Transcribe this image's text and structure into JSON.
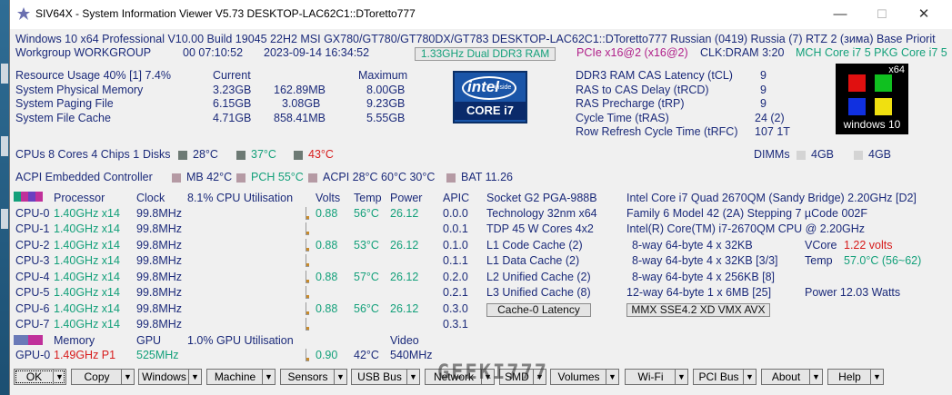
{
  "window": {
    "title": "SIV64X - System Information Viewer V5.73 DESKTOP-LAC62C1::DToretto777",
    "minimize": "—",
    "maximize": "☐",
    "close": "✕"
  },
  "sysline1": "Windows 10 x64 Professional  V10.00  Build 19045  22H2  MSI GX780/GT780/GT780DX/GT783  DESKTOP-LAC62C1::DToretto777  Russian (0419)  Russia (7)  RTZ 2 (зима)  Base Priorit",
  "sysline2": {
    "workgroup": "Workgroup WORKGROUP",
    "uptime": "00 07:10:52",
    "datetime": "2023-09-14 16:34:52",
    "mem_box": "1.33GHz Dual DDR3 RAM",
    "pcie": "PCIe x16@2 (x16@2)",
    "clk": "CLK:DRAM 3:20",
    "mch": "MCH Core i7 5  PKG Core i7 5"
  },
  "resources": {
    "header": "Resource Usage 40% [1] 7.4%",
    "current_h": "Current",
    "maximum_h": "Maximum",
    "rows": [
      {
        "label": "System Physical Memory",
        "cur": "3.23GB",
        "free": "162.89MB",
        "max": "8.00GB"
      },
      {
        "label": "System Paging File",
        "cur": "6.15GB",
        "free": "3.08GB",
        "max": "9.23GB"
      },
      {
        "label": "System File Cache",
        "cur": "4.71GB",
        "free": "858.41MB",
        "max": "5.55GB"
      }
    ]
  },
  "intel_logo": {
    "brand": "intel",
    "inside": "inside",
    "model": "CORE i7"
  },
  "win10_logo": {
    "x64": "x64",
    "label": "windows 10"
  },
  "timings": [
    {
      "label": "DDR3 RAM CAS Latency (tCL)",
      "value": "9"
    },
    {
      "label": "RAS to CAS Delay (tRCD)",
      "value": "9"
    },
    {
      "label": "RAS Precharge (tRP)",
      "value": "9"
    },
    {
      "label": "Cycle Time (tRAS)",
      "value": "24 (2)"
    },
    {
      "label": "Row Refresh Cycle Time (tRFC)",
      "value": "107 1T"
    }
  ],
  "cpus_line": {
    "label": "CPUs 8 Cores 4 Chips 1",
    "disks": "Disks",
    "d1": "28°C",
    "d2": "37°C",
    "d3": "43°C",
    "dimms": "DIMMs",
    "dimm1": "4GB",
    "dimm2": "4GB"
  },
  "acpi_line": {
    "label": "ACPI Embedded Controller",
    "mb": "MB 42°C",
    "pch": "PCH 55°C",
    "acpi": "ACPI 28°C 60°C 30°C",
    "bat": "BAT 11.26"
  },
  "cpu_table": {
    "h_processor": "Processor",
    "h_clock": "Clock",
    "h_util": "8.1% CPU Utilisation",
    "h_volts": "Volts",
    "h_temp": "Temp",
    "h_power": "Power",
    "h_apic": "APIC",
    "rows": [
      {
        "name": "CPU-0",
        "freq": "1.40GHz x14",
        "clock": "99.8MHz",
        "volts": "0.88",
        "temp": "56°C",
        "power": "26.12",
        "apic": "0.0.0"
      },
      {
        "name": "CPU-1",
        "freq": "1.40GHz x14",
        "clock": "99.8MHz",
        "volts": "",
        "temp": "",
        "power": "",
        "apic": "0.0.1"
      },
      {
        "name": "CPU-2",
        "freq": "1.40GHz x14",
        "clock": "99.8MHz",
        "volts": "0.88",
        "temp": "53°C",
        "power": "26.12",
        "apic": "0.1.0"
      },
      {
        "name": "CPU-3",
        "freq": "1.40GHz x14",
        "clock": "99.8MHz",
        "volts": "",
        "temp": "",
        "power": "",
        "apic": "0.1.1"
      },
      {
        "name": "CPU-4",
        "freq": "1.40GHz x14",
        "clock": "99.8MHz",
        "volts": "0.88",
        "temp": "57°C",
        "power": "26.12",
        "apic": "0.2.0"
      },
      {
        "name": "CPU-5",
        "freq": "1.40GHz x14",
        "clock": "99.8MHz",
        "volts": "",
        "temp": "",
        "power": "",
        "apic": "0.2.1"
      },
      {
        "name": "CPU-6",
        "freq": "1.40GHz x14",
        "clock": "99.8MHz",
        "volts": "0.88",
        "temp": "56°C",
        "power": "26.12",
        "apic": "0.3.0"
      },
      {
        "name": "CPU-7",
        "freq": "1.40GHz x14",
        "clock": "99.8MHz",
        "volts": "",
        "temp": "",
        "power": "",
        "apic": "0.3.1"
      }
    ]
  },
  "cpu_info": {
    "socket": "Socket G2 PGA-988B",
    "tech": "Technology 32nm  x64",
    "tdp": "TDP 45 W Cores 4x2",
    "l1c": "L1 Code Cache (2)",
    "l1d": "L1 Data Cache (2)",
    "l2": "L2 Unified Cache (2)",
    "l3": "L3 Unified Cache (8)",
    "latency_btn": "Cache-0 Latency"
  },
  "cpu_right": {
    "model": "Intel Core i7 Quad 2670QM (Sandy Bridge) 2.20GHz [D2]",
    "family": "Family 6  Model 42 (2A)  Stepping 7  µCode 002F",
    "brand": "Intel(R) Core(TM) i7-2670QM CPU @ 2.20GHz",
    "c1": "8-way 64-byte  4 x 32KB",
    "vcore_l": "VCore",
    "vcore_v": "1.22 volts",
    "c2": "8-way 64-byte  4 x 32KB [3/3]",
    "temp_l": "Temp",
    "temp_v": "57.0°C (56~62)",
    "c3": "8-way 64-byte  4 x 256KB [8]",
    "c4": "12-way 64-byte  1 x 6MB  [25]",
    "power": "Power  12.03 Watts",
    "features": "MMX SSE4.2 XD VMX AVX"
  },
  "gpu": {
    "h_memory": "Memory",
    "h_gpu": "GPU",
    "h_util": "1.0% GPU Utilisation",
    "h_video": "Video",
    "name": "GPU-0",
    "freq": "1.49GHz P1",
    "clock": "525MHz",
    "volts": "0.90",
    "temp": "42°C",
    "video": "540MHz"
  },
  "buttons": [
    "OK",
    "Copy",
    "Windows",
    "Machine",
    "Sensors",
    "USB Bus",
    "Network",
    "SMD",
    "Volumes",
    "Wi-Fi",
    "PCI Bus",
    "About",
    "Help"
  ],
  "watermark": "GEEKI777",
  "colors": {
    "text": "#1b2a7a",
    "value_green": "#13a07a",
    "alert_red": "#d71b1b",
    "win_red": "#e01010",
    "win_green": "#10c020",
    "win_blue": "#1030e0",
    "win_yellow": "#f0e010"
  }
}
